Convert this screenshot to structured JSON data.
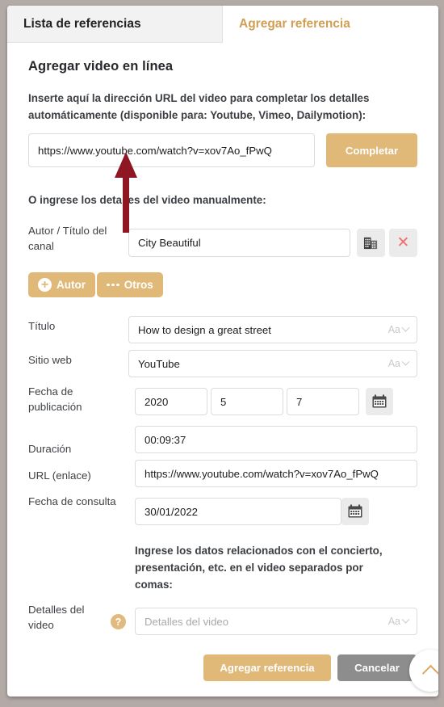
{
  "tabs": [
    {
      "label": "Lista de referencias",
      "active": false
    },
    {
      "label": "Agregar referencia",
      "active": true
    }
  ],
  "form": {
    "heading": "Agregar video en línea",
    "url_lead": "Inserte aquí la dirección URL del video para completar los detalles automáticamente (disponible para: Youtube, Vimeo, Dailymotion):",
    "url_value": "https://www.youtube.com/watch?v=xov7Ao_fPwQ",
    "complete_button": "Completar",
    "manual_subhead": "O ingrese los detalles del video manualmente:",
    "author_label": "Autor / Título del canal",
    "author_value": "City Beautiful",
    "institution_icon": "building-icon",
    "delete_icon": "close-x-icon",
    "add_author_button": "Autor",
    "add_other_button": "Otros",
    "fields": [
      {
        "label": "Título",
        "value": "How to design a great street",
        "aa": true
      },
      {
        "label": "Sitio web",
        "value": "YouTube",
        "aa": true
      },
      {
        "label": "Duración",
        "value": "00:09:37",
        "aa": false
      },
      {
        "label": "URL (enlace)",
        "value": "https://www.youtube.com/watch?v=xov7Ao_fPwQ",
        "aa": false
      }
    ],
    "pub_date": {
      "label": "Fecha de publicación",
      "year": "2020",
      "month": "5",
      "day": "7",
      "calendar_icon": "calendar-icon"
    },
    "access_date": {
      "label": "Fecha de consulta",
      "value": "30/01/2022",
      "calendar_icon": "calendar-icon"
    },
    "details_note": "Ingrese los datos relacionados con el concierto, presentación, etc. en el video separados por comas:",
    "details_label": "Detalles del video",
    "details_placeholder": "Detalles del video",
    "details_help": "?",
    "aa_label": "Aa"
  },
  "actions": {
    "submit": "Agregar referencia",
    "cancel": "Cancelar"
  },
  "scroll_top_icon": "chevron-up-icon",
  "colors": {
    "gold": "#e0b878",
    "gold_text": "#cf9f53",
    "gray_button": "#8d8d8d",
    "delete_red": "#f0706e",
    "page_background": "#b3aaa6",
    "arrow_red": "#8f1723"
  }
}
